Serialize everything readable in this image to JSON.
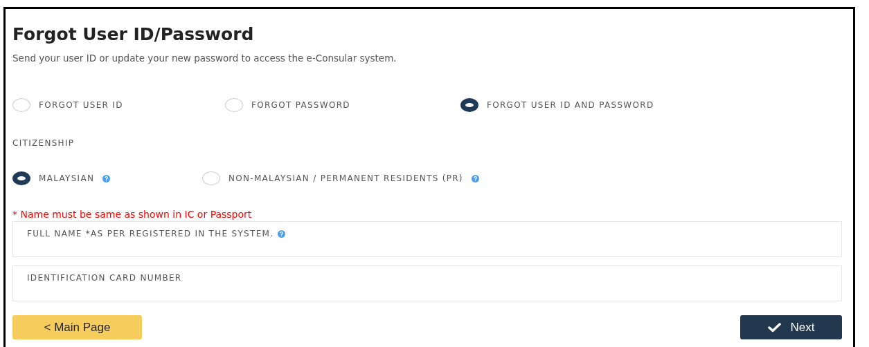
{
  "title": "Forgot User ID/Password",
  "subtitle": "Send your user ID or update your new password to access the e-Consular system.",
  "recovery_options": [
    {
      "label": "FORGOT USER ID",
      "selected": false
    },
    {
      "label": "FORGOT PASSWORD",
      "selected": false
    },
    {
      "label": "FORGOT USER ID AND PASSWORD",
      "selected": true
    }
  ],
  "citizenship": {
    "label": "CITIZENSHIP",
    "options": [
      {
        "label": "MALAYSIAN",
        "selected": true,
        "help": true
      },
      {
        "label": "NON-MALAYSIAN / PERMANENT RESIDENTS (PR)",
        "selected": false,
        "help": true
      }
    ]
  },
  "note": "* Name must be same as shown in IC or Passport",
  "fields": [
    {
      "label": "FULL NAME *AS PER REGISTERED IN THE SYSTEM.",
      "help": true
    },
    {
      "label": "IDENTIFICATION CARD NUMBER",
      "help": false
    }
  ],
  "buttons": [
    {
      "label": "< Main Page",
      "kind": "back"
    },
    {
      "label": "Next",
      "kind": "next"
    }
  ]
}
